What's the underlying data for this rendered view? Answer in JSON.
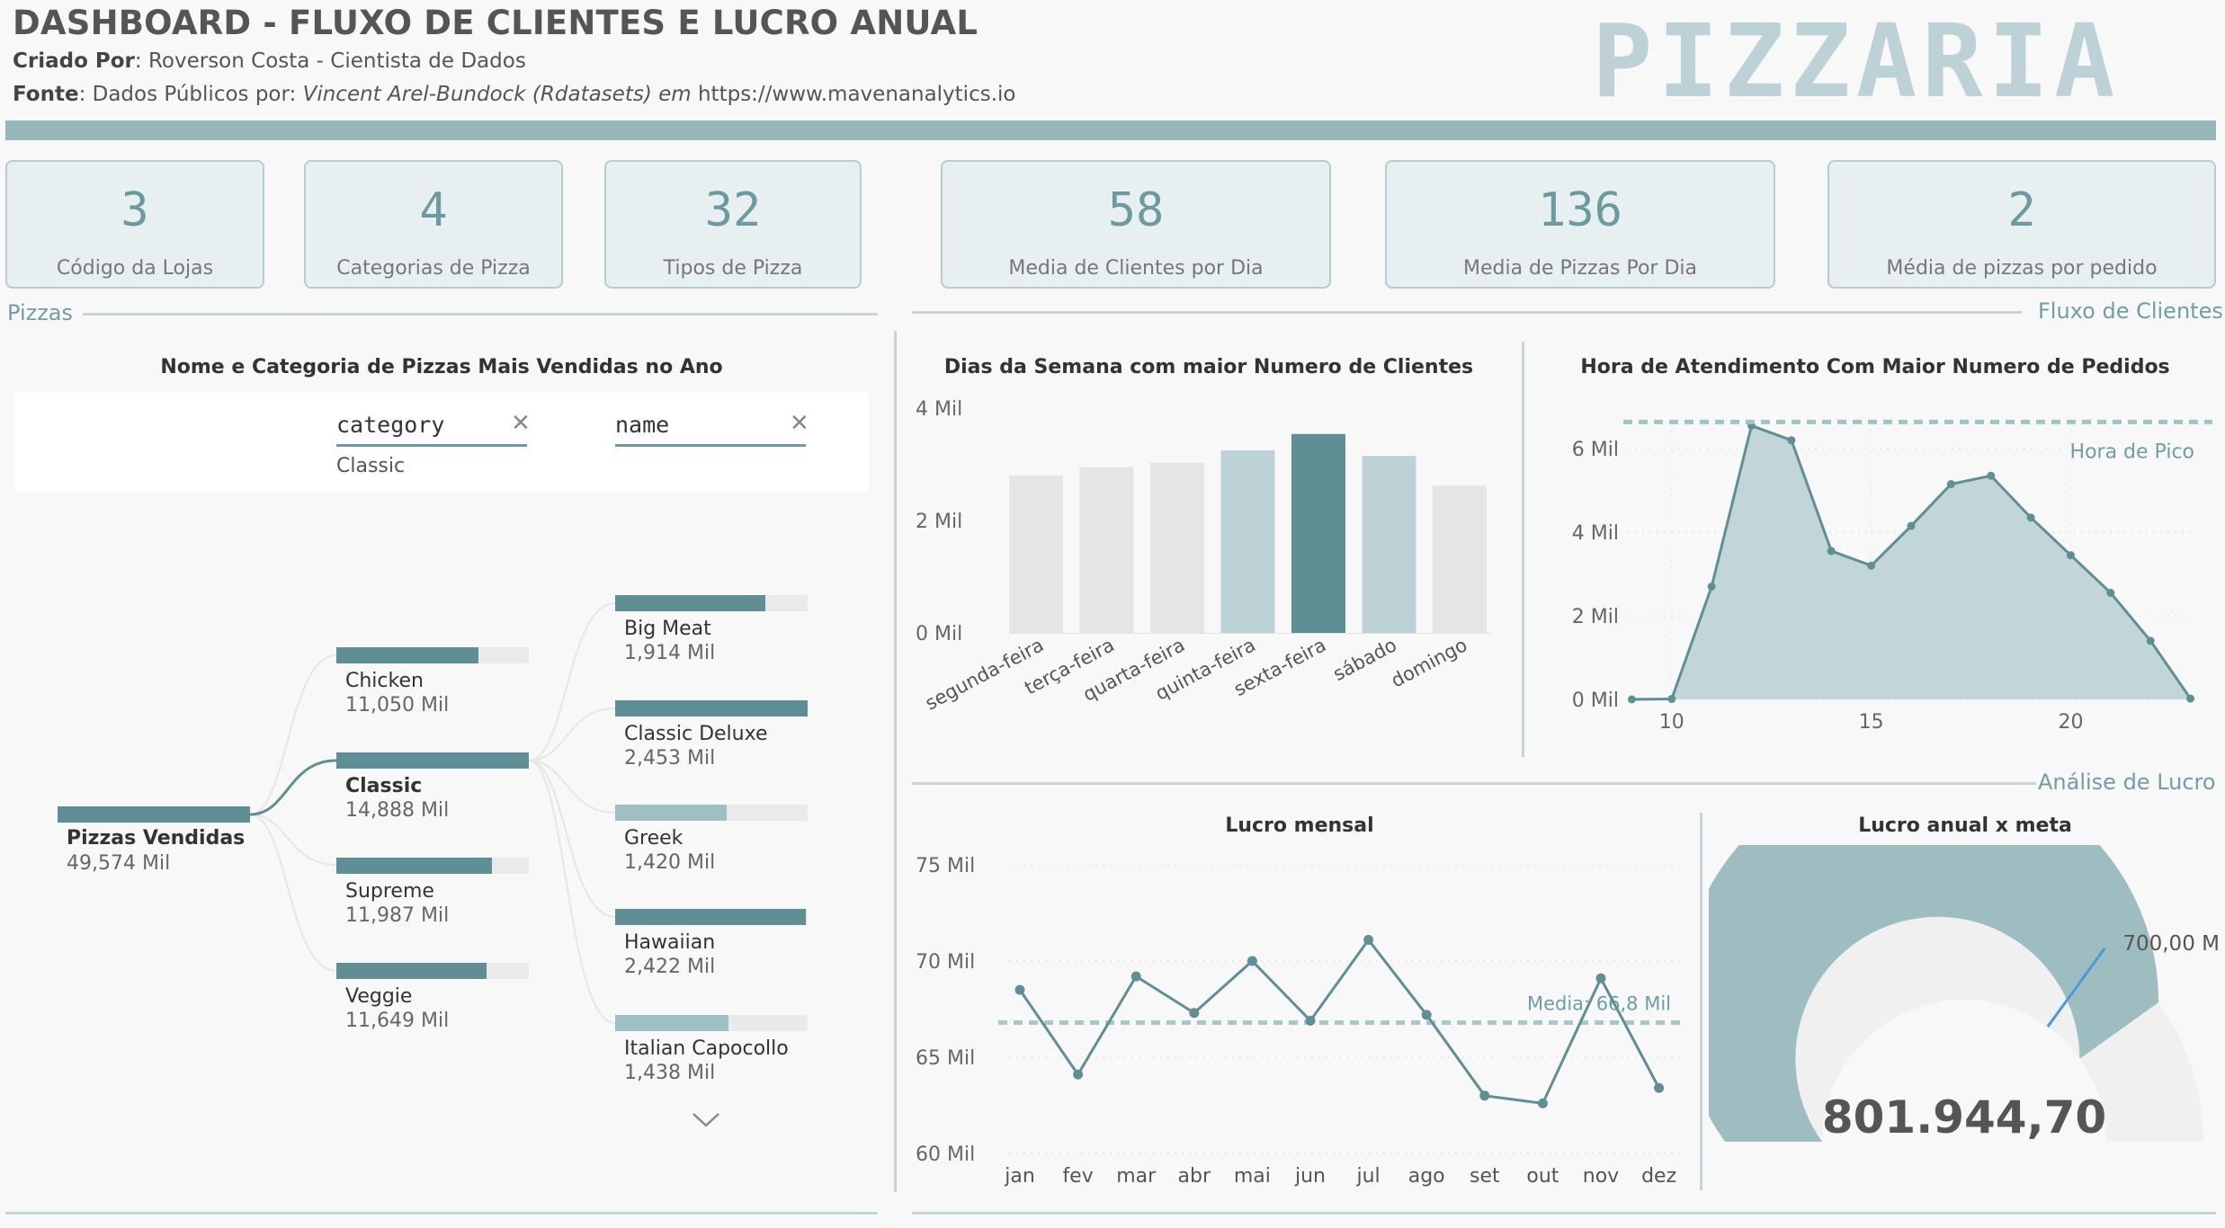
{
  "header": {
    "title": "DASHBOARD - FLUXO DE CLIENTES E LUCRO ANUAL",
    "created_label": "Criado Por",
    "created_value": ": Roverson Costa - Cientista de Dados",
    "source_label": "Fonte",
    "source_prefix": ": Dados Públicos por: ",
    "source_italic": "Vincent Arel-Bundock (Rdatasets) em",
    "source_url": " https://www.mavenanalytics.io",
    "brand": "PIZZARIA"
  },
  "kpis": [
    {
      "value": "3",
      "label": "Código da Lojas"
    },
    {
      "value": "4",
      "label": "Categorias de Pizza"
    },
    {
      "value": "32",
      "label": "Tipos de Pizza"
    },
    {
      "value": "58",
      "label": "Media de Clientes por Dia"
    },
    {
      "value": "136",
      "label": "Media de Pizzas Por Dia"
    },
    {
      "value": "2",
      "label": "Média de pizzas por pedido"
    }
  ],
  "sections": {
    "pizzas": "Pizzas",
    "fluxo": "Fluxo de Clientes",
    "lucro": "Análise de Lucro"
  },
  "tree": {
    "title": "Nome e Categoria de Pizzas Mais Vendidas no Ano",
    "filter_category": "category",
    "filter_name": "name",
    "filter_category_value": "Classic",
    "root": {
      "name": "Pizzas Vendidas",
      "value": "49,574 Mil",
      "share": 1.0
    },
    "categories": [
      {
        "name": "Chicken",
        "value": "11,050 Mil",
        "share": 0.74
      },
      {
        "name": "Classic",
        "value": "14,888 Mil",
        "share": 1.0
      },
      {
        "name": "Supreme",
        "value": "11,987 Mil",
        "share": 0.81
      },
      {
        "name": "Veggie",
        "value": "11,649 Mil",
        "share": 0.78
      }
    ],
    "names": [
      {
        "name": "Big Meat",
        "value": "1,914 Mil",
        "share": 0.78
      },
      {
        "name": "Classic Deluxe",
        "value": "2,453 Mil",
        "share": 1.0
      },
      {
        "name": "Greek",
        "value": "1,420 Mil",
        "share": 0.58
      },
      {
        "name": "Hawaiian",
        "value": "2,422 Mil",
        "share": 0.99
      },
      {
        "name": "Italian Capocollo",
        "value": "1,438 Mil",
        "share": 0.59
      }
    ]
  },
  "chart_data": [
    {
      "type": "bar",
      "title": "Dias da Semana com maior Numero de Clientes",
      "categories": [
        "segunda-feira",
        "terça-feira",
        "quarta-feira",
        "quinta-feira",
        "sexta-feira",
        "sábado",
        "domingo"
      ],
      "values": [
        2800,
        2950,
        3030,
        3250,
        3540,
        3150,
        2620
      ],
      "yticks": [
        "0 Mil",
        "2 Mil",
        "4 Mil"
      ],
      "ylim": [
        0,
        4000
      ],
      "colors": [
        "#e5e5e5",
        "#e5e5e5",
        "#e5e5e5",
        "#bcd2d6",
        "#5f8f95",
        "#bcd2d6",
        "#e5e5e5"
      ]
    },
    {
      "type": "area",
      "title": "Hora de Atendimento Com Maior Numero de Pedidos",
      "x": [
        9,
        10,
        11,
        12,
        13,
        14,
        15,
        16,
        17,
        18,
        19,
        20,
        21,
        22,
        23
      ],
      "values": [
        0,
        10,
        2700,
        6550,
        6200,
        3550,
        3200,
        4150,
        5150,
        5350,
        4350,
        3450,
        2550,
        1400,
        20
      ],
      "yticks": [
        "0 Mil",
        "2 Mil",
        "4 Mil",
        "6 Mil"
      ],
      "xticks": [
        "10",
        "15",
        "20"
      ],
      "ylim": [
        0,
        7000
      ],
      "reference": {
        "label": "Hora de Pico",
        "value": 6550
      }
    },
    {
      "type": "line",
      "title": "Lucro mensal",
      "categories": [
        "jan",
        "fev",
        "mar",
        "abr",
        "mai",
        "jun",
        "jul",
        "ago",
        "set",
        "out",
        "nov",
        "dez"
      ],
      "values": [
        68.5,
        64.1,
        69.2,
        67.3,
        70.0,
        66.9,
        71.1,
        67.2,
        63.0,
        62.6,
        69.1,
        63.4
      ],
      "yticks": [
        "60 Mil",
        "65 Mil",
        "70 Mil",
        "75 Mil"
      ],
      "ylim": [
        60,
        75
      ],
      "reference": {
        "label": "Media: 66,8 Mil",
        "value": 66.8
      }
    },
    {
      "type": "gauge",
      "title": "Lucro anual x meta",
      "value_label": "801.944,70",
      "value": 801944.7,
      "target_label": "700,00 Mil",
      "target": 700000,
      "max": 1000000
    }
  ],
  "colors": {
    "accent": "#5f8f95",
    "light_accent": "#bcd2d6",
    "gauge_fill": "#9ebdc1",
    "target_line": "#4a9ad8"
  }
}
